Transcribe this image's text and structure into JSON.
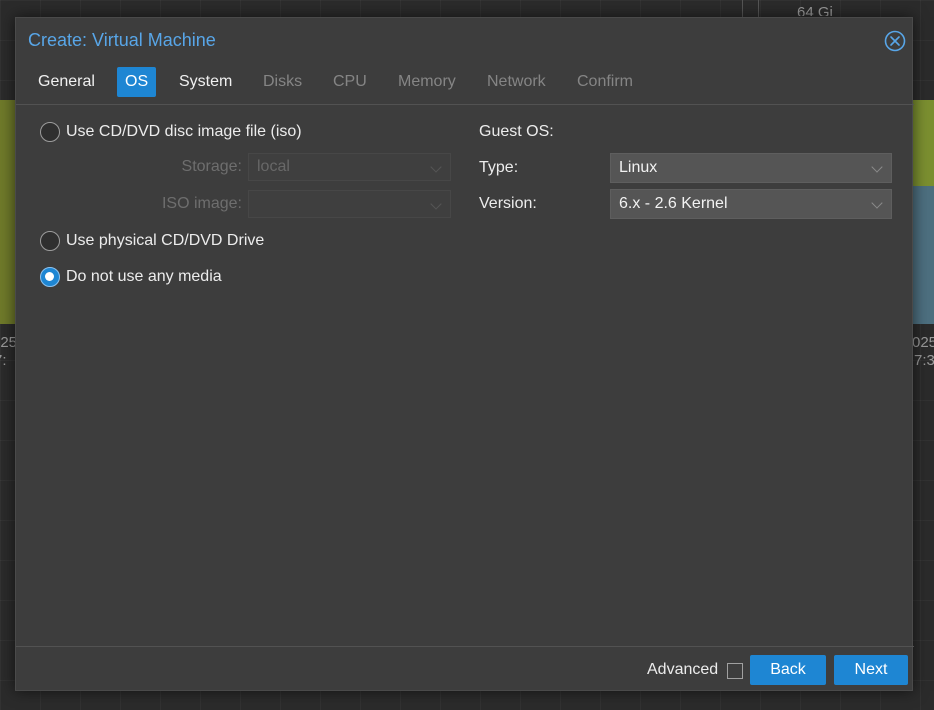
{
  "background": {
    "top_value": "64 Gi",
    "left_date": "025",
    "left_time": "7:",
    "right_date": "025",
    "right_time": "7:3"
  },
  "dialog": {
    "title": "Create: Virtual Machine",
    "close_icon": "close-circle-icon"
  },
  "tabs": [
    {
      "label": "General",
      "state": "enabled"
    },
    {
      "label": "OS",
      "state": "active"
    },
    {
      "label": "System",
      "state": "enabled"
    },
    {
      "label": "Disks",
      "state": "disabled"
    },
    {
      "label": "CPU",
      "state": "disabled"
    },
    {
      "label": "Memory",
      "state": "disabled"
    },
    {
      "label": "Network",
      "state": "disabled"
    },
    {
      "label": "Confirm",
      "state": "disabled"
    }
  ],
  "media": {
    "iso_option": {
      "label": "Use CD/DVD disc image file (iso)",
      "checked": false
    },
    "storage": {
      "label": "Storage:",
      "value": "local",
      "disabled": true
    },
    "iso_image": {
      "label": "ISO image:",
      "value": "",
      "disabled": true
    },
    "physical_option": {
      "label": "Use physical CD/DVD Drive",
      "checked": false
    },
    "none_option": {
      "label": "Do not use any media",
      "checked": true
    }
  },
  "guest_os": {
    "heading": "Guest OS:",
    "type_label": "Type:",
    "type_value": "Linux",
    "version_label": "Version:",
    "version_value": "6.x - 2.6 Kernel"
  },
  "footer": {
    "advanced_label": "Advanced",
    "advanced_checked": false,
    "back_label": "Back",
    "next_label": "Next"
  },
  "colors": {
    "accent": "#1e86d3",
    "title": "#58a6e8",
    "panel": "#3d3d3d"
  }
}
